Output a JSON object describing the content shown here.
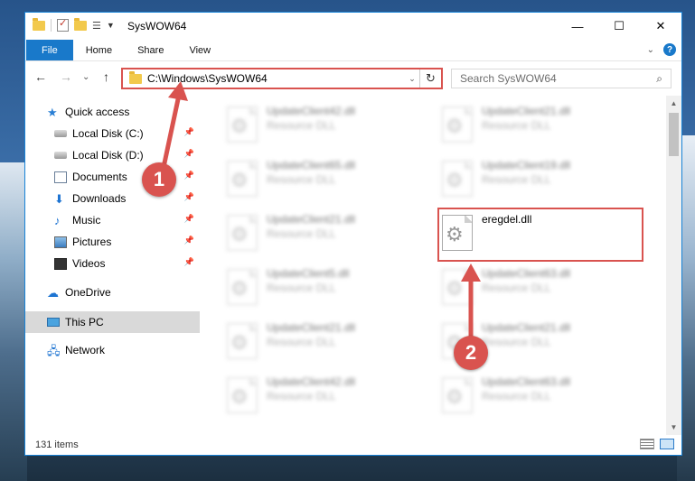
{
  "window": {
    "title": "SysWOW64",
    "controls": {
      "minimize": "—",
      "maximize": "☐",
      "close": "✕"
    }
  },
  "ribbon": {
    "tabs": [
      "File",
      "Home",
      "Share",
      "View"
    ],
    "chevron": "⌄",
    "help": "?"
  },
  "navigation": {
    "back": "←",
    "forward": "→",
    "recent": "⌄",
    "up": "↑",
    "address": "C:\\Windows\\SysWOW64",
    "address_dropdown": "⌄",
    "refresh": "↻",
    "search_placeholder": "Search SysWOW64",
    "search_icon": "⌕"
  },
  "sidebar": {
    "items": [
      {
        "label": "Quick access",
        "icon": "star-icon",
        "pinned": false
      },
      {
        "label": "Local Disk (C:)",
        "icon": "drive-icon",
        "pinned": true
      },
      {
        "label": "Local Disk (D:)",
        "icon": "drive-icon",
        "pinned": true
      },
      {
        "label": "Documents",
        "icon": "documents-icon",
        "pinned": true
      },
      {
        "label": "Downloads",
        "icon": "downloads-icon",
        "pinned": true
      },
      {
        "label": "Music",
        "icon": "music-icon",
        "pinned": true
      },
      {
        "label": "Pictures",
        "icon": "pictures-icon",
        "pinned": true
      },
      {
        "label": "Videos",
        "icon": "videos-icon",
        "pinned": true
      },
      {
        "label": "OneDrive",
        "icon": "onedrive-icon",
        "pinned": false
      },
      {
        "label": "This PC",
        "icon": "pc-icon",
        "pinned": false,
        "selected": true
      },
      {
        "label": "Network",
        "icon": "network-icon",
        "pinned": false
      }
    ]
  },
  "files": [
    {
      "name": "UpdateClient42.dll",
      "type": "Resource DLL",
      "blurred": true
    },
    {
      "name": "UpdateClient21.dll",
      "type": "Resource DLL",
      "blurred": true
    },
    {
      "name": "UpdateClient65.dll",
      "type": "Resource DLL",
      "blurred": true
    },
    {
      "name": "UpdateClient19.dll",
      "type": "Resource DLL",
      "blurred": true
    },
    {
      "name": "UpdateClient21.dll",
      "type": "Resource DLL",
      "blurred": true
    },
    {
      "name": "eregdel.dll",
      "type": "",
      "blurred": false
    },
    {
      "name": "UpdateClient5.dll",
      "type": "Resource DLL",
      "blurred": true
    },
    {
      "name": "UpdateClient63.dll",
      "type": "Resource DLL",
      "blurred": true
    },
    {
      "name": "UpdateClient21.dll",
      "type": "Resource DLL",
      "blurred": true
    },
    {
      "name": "UpdateClient21.dll",
      "type": "Resource DLL",
      "blurred": true
    },
    {
      "name": "UpdateClient42.dll",
      "type": "Resource DLL",
      "blurred": true
    },
    {
      "name": "UpdateClient63.dll",
      "type": "Resource DLL",
      "blurred": true
    }
  ],
  "status": {
    "item_count": "131 items"
  },
  "annotations": {
    "step1": "1",
    "step2": "2",
    "color": "#d9534f"
  }
}
